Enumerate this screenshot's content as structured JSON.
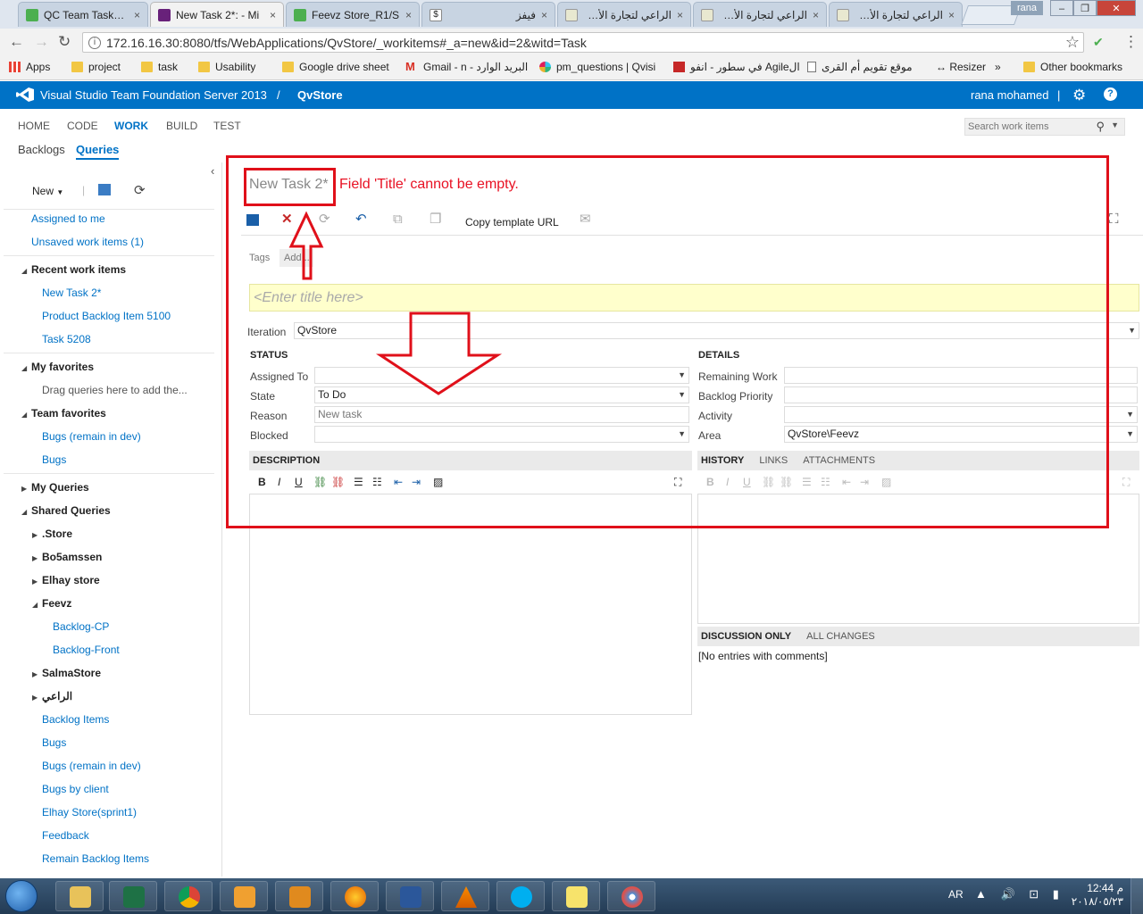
{
  "browser": {
    "tabs": [
      {
        "label": "QC Team Tasks_Q"
      },
      {
        "label": "New Task 2*: - Mi"
      },
      {
        "label": "Feevz Store_R1/S"
      },
      {
        "label": "فيفز"
      },
      {
        "label": "الراعي لتجارة الأغنام"
      },
      {
        "label": "الراعي لتجارة الأغنام"
      },
      {
        "label": "الراعي لتجارة الأغنام"
      }
    ],
    "profile": "rana",
    "url": "172.16.16.30:8080/tfs/WebApplications/QvStore/_workitems#_a=new&id=2&witd=Task",
    "bookmarks": [
      {
        "label": "Apps"
      },
      {
        "label": "project"
      },
      {
        "label": "task"
      },
      {
        "label": "Usability"
      },
      {
        "label": "Google drive sheet"
      },
      {
        "label": "البريد الوارد - Gmail - n"
      },
      {
        "label": "pm_questions | Qvisi"
      },
      {
        "label": "الAgile في سطور - انفو"
      },
      {
        "label": "موقع تقويم أم القرى"
      },
      {
        "label": "↔ Resizer"
      },
      {
        "label": "»"
      },
      {
        "label": "Other bookmarks"
      }
    ]
  },
  "tfs": {
    "product": "Visual Studio Team Foundation Server 2013",
    "separator": "/",
    "project": "QvStore",
    "user": "rana mohamed",
    "user_separator": "|",
    "hubs": [
      "HOME",
      "CODE",
      "WORK",
      "BUILD",
      "TEST"
    ],
    "pivots": [
      "Backlogs",
      "Queries"
    ],
    "search_placeholder": "Search work items"
  },
  "left": {
    "new_label": "New",
    "items": [
      {
        "label": "Assigned to me"
      },
      {
        "label": "Unsaved work items (1)"
      },
      {
        "label": "Recent work items"
      },
      {
        "label": "New Task 2*"
      },
      {
        "label": "Product Backlog Item 5100"
      },
      {
        "label": "Task 5208"
      },
      {
        "label": "My favorites"
      },
      {
        "label": "Drag queries here to add the..."
      },
      {
        "label": "Team favorites"
      },
      {
        "label": "Bugs (remain in dev)"
      },
      {
        "label": "Bugs"
      },
      {
        "label": "My Queries"
      },
      {
        "label": "Shared Queries"
      },
      {
        "label": ".Store"
      },
      {
        "label": "Bo5amssen"
      },
      {
        "label": "Elhay store"
      },
      {
        "label": "Feevz"
      },
      {
        "label": "Backlog-CP"
      },
      {
        "label": "Backlog-Front"
      },
      {
        "label": "SalmaStore"
      },
      {
        "label": "الراعي"
      },
      {
        "label": "Backlog Items"
      },
      {
        "label": "Bugs"
      },
      {
        "label": "Bugs (remain in dev)"
      },
      {
        "label": "Bugs by client"
      },
      {
        "label": "Elhay Store(sprint1)"
      },
      {
        "label": "Feedback"
      },
      {
        "label": "Remain Backlog Items"
      }
    ]
  },
  "form": {
    "title": "New Task 2*",
    "error": "Field 'Title' cannot be empty.",
    "copy_template": "Copy template URL",
    "tags_label": "Tags",
    "tags_add": "Add...",
    "title_placeholder": "<Enter title here>",
    "iteration_label": "Iteration",
    "iteration_value": "QvStore",
    "status_header": "STATUS",
    "details_header": "DETAILS",
    "assigned_to_label": "Assigned To",
    "assigned_to_value": "",
    "state_label": "State",
    "state_value": "To Do",
    "reason_label": "Reason",
    "reason_value": "New task",
    "blocked_label": "Blocked",
    "blocked_value": "",
    "remaining_work_label": "Remaining Work",
    "backlog_priority_label": "Backlog Priority",
    "activity_label": "Activity",
    "area_label": "Area",
    "area_value": "QvStore\\Feevz",
    "description_header": "DESCRIPTION",
    "history_tab": "HISTORY",
    "links_tab": "LINKS",
    "attachments_tab": "ATTACHMENTS",
    "discussion_tab": "DISCUSSION ONLY",
    "all_changes_tab": "ALL CHANGES",
    "history_empty": "[No entries with comments]"
  },
  "taskbar": {
    "language": "AR",
    "time": "12:44 م",
    "date": "٢٠١٨/٠٥/٢٣"
  },
  "colors": {
    "accent": "#0072c6",
    "annotation": "#e0101a",
    "error_text": "#e81123",
    "title_field_bg": "#ffffcc"
  }
}
